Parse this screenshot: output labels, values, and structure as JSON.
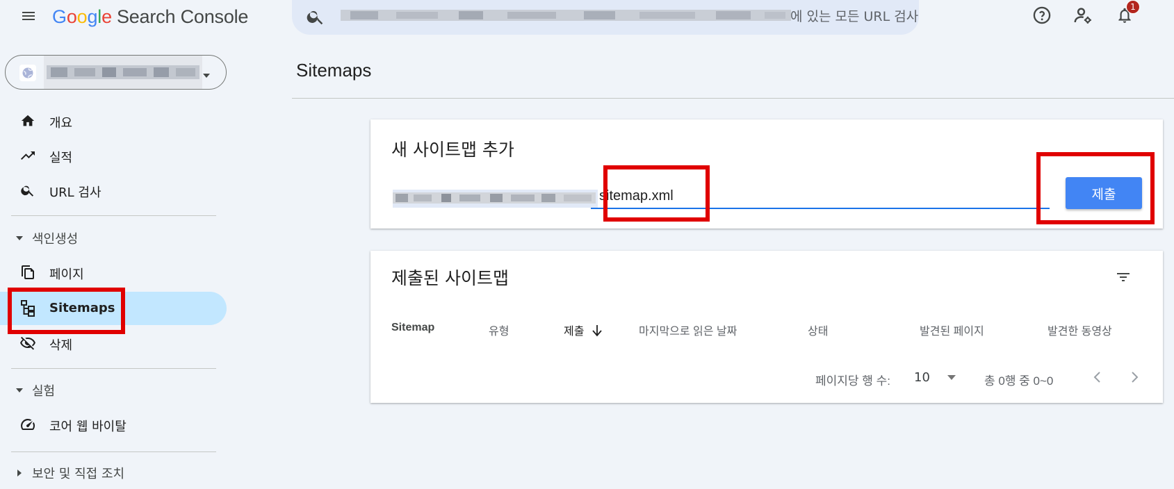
{
  "app": {
    "logo_letters": [
      "G",
      "o",
      "o",
      "g",
      "l",
      "e"
    ],
    "logo_colors": [
      "#4285f4",
      "#ea4335",
      "#fbbc05",
      "#4285f4",
      "#34a853",
      "#ea4335"
    ],
    "product": "Search Console",
    "search_text": "에 있는 모든 URL 검사",
    "notification_count": "1"
  },
  "sidebar": {
    "items": [
      {
        "label": "개요",
        "icon": "home-icon"
      },
      {
        "label": "실적",
        "icon": "trending-up-icon"
      },
      {
        "label": "URL 검사",
        "icon": "search-icon"
      }
    ],
    "sections": [
      {
        "label": "색인생성",
        "items": [
          {
            "label": "페이지",
            "icon": "pages-icon"
          },
          {
            "label": "Sitemaps",
            "icon": "sitemap-icon",
            "active": true
          },
          {
            "label": "삭제",
            "icon": "visibility-off-icon"
          }
        ]
      },
      {
        "label": "실험",
        "items": [
          {
            "label": "코어 웹 바이탈",
            "icon": "speed-gauge-icon"
          }
        ]
      },
      {
        "label": "보안 및 직접 조치",
        "collapsed": true
      }
    ]
  },
  "page": {
    "title": "Sitemaps",
    "add_card": {
      "title": "새 사이트맵 추가",
      "input_value": "sitemap.xml",
      "submit_label": "제출"
    },
    "submitted_card": {
      "title": "제출된 사이트맵",
      "columns": [
        "Sitemap",
        "유형",
        "제출",
        "마지막으로 읽은 날짜",
        "상태",
        "발견된 페이지",
        "발견한 동영상"
      ],
      "sort_column": "제출",
      "rows_per_page_label": "페이지당 행 수:",
      "rows_per_page_value": "10",
      "range_text": "총 0행 중 0~0"
    }
  },
  "colors": {
    "accent": "#1a73e8",
    "button": "#4285f4",
    "active_nav": "#c2e7ff",
    "highlight": "#e00000",
    "background": "#f0f4f9"
  }
}
